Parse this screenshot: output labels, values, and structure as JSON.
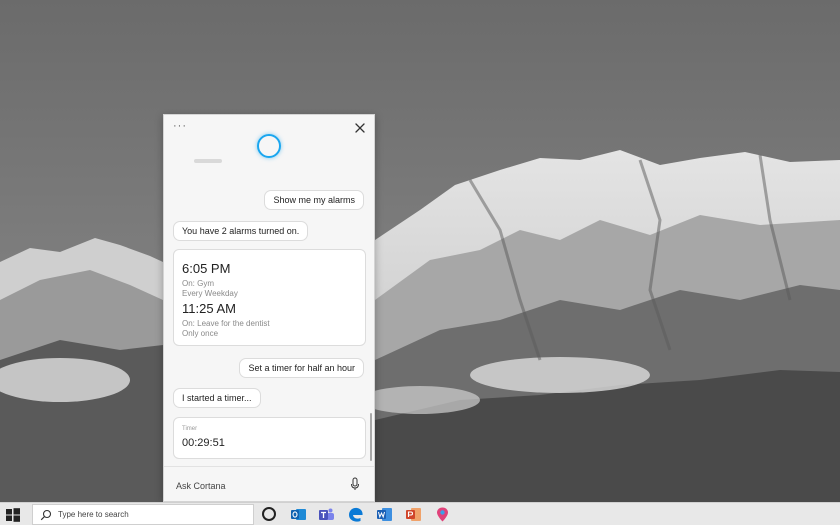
{
  "cortana": {
    "conversation": [
      {
        "role": "user",
        "text": "Show me my alarms"
      },
      {
        "role": "assistant",
        "text": "You have 2 alarms turned on."
      }
    ],
    "alarms": [
      {
        "time": "6:05 PM",
        "label": "On: Gym",
        "repeat": "Every Weekday"
      },
      {
        "time": "11:25 AM",
        "label": "On: Leave for the dentist",
        "repeat": "Only once"
      }
    ],
    "timer_request": "Set a timer for half an hour",
    "timer_reply": "I started a timer...",
    "timer": {
      "label": "Timer",
      "value": "00:29:51"
    },
    "ask_placeholder": "Ask Cortana",
    "accent": "#1aa6ef"
  },
  "taskbar": {
    "search_placeholder": "Type here to search",
    "apps": [
      "cortana-icon",
      "outlook-icon",
      "teams-icon",
      "edge-icon",
      "word-icon",
      "office-icon",
      "maps-icon"
    ]
  }
}
